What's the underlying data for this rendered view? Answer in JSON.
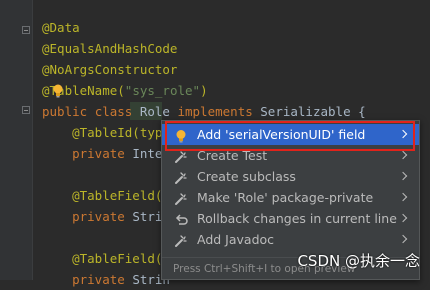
{
  "code_lines": [
    {
      "segments": [
        {
          "t": "@Data",
          "c": "ann"
        }
      ]
    },
    {
      "segments": [
        {
          "t": "@EqualsAndHashCode",
          "c": "ann"
        }
      ]
    },
    {
      "segments": [
        {
          "t": "@NoArgsConstructor",
          "c": "ann"
        }
      ]
    },
    {
      "segments": [
        {
          "t": "@TableName(",
          "c": "ann"
        },
        {
          "t": "\"sys_role\"",
          "c": "str"
        },
        {
          "t": ")",
          "c": "ann"
        }
      ]
    },
    {
      "segments": [
        {
          "t": "public ",
          "c": "kw"
        },
        {
          "t": "class ",
          "c": "kw"
        },
        {
          "t": "Role ",
          "c": "cls"
        },
        {
          "t": "implements ",
          "c": "kw"
        },
        {
          "t": "Serializable {",
          "c": "cls"
        }
      ]
    },
    {
      "segments": [
        {
          "t": "    @TableId(type",
          "c": "ann"
        }
      ]
    },
    {
      "segments": [
        {
          "t": "    private ",
          "c": "kw"
        },
        {
          "t": "Integ",
          "c": "cls"
        }
      ]
    },
    {
      "segments": [
        {
          "t": "",
          "c": "cls"
        }
      ]
    },
    {
      "segments": [
        {
          "t": "    @TableField(v",
          "c": "ann"
        }
      ]
    },
    {
      "segments": [
        {
          "t": "    private ",
          "c": "kw"
        },
        {
          "t": "Strin",
          "c": "cls"
        }
      ]
    },
    {
      "segments": [
        {
          "t": "",
          "c": "cls"
        }
      ]
    },
    {
      "segments": [
        {
          "t": "    @TableField(v",
          "c": "ann"
        }
      ]
    },
    {
      "segments": [
        {
          "t": "    private ",
          "c": "kw"
        },
        {
          "t": "Strin",
          "c": "cls"
        }
      ]
    }
  ],
  "popup": {
    "items": [
      {
        "label": "Add 'serialVersionUID' field",
        "icon": "bulb-icon",
        "selected": true
      },
      {
        "label": "Create Test",
        "icon": "quickfix-icon",
        "selected": false
      },
      {
        "label": "Create subclass",
        "icon": "quickfix-icon",
        "selected": false
      },
      {
        "label": "Make 'Role' package-private",
        "icon": "quickfix-icon",
        "selected": false
      },
      {
        "label": "Rollback changes in current line",
        "icon": "rollback-icon",
        "selected": false
      },
      {
        "label": "Add Javadoc",
        "icon": "quickfix-icon",
        "selected": false
      }
    ],
    "footer": "Press Ctrl+Shift+I to open preview"
  },
  "watermark": "CSDN @执余一念",
  "colors": {
    "editor_bg": "#2b2b2b",
    "annotation": "#bbb529",
    "keyword": "#cc7832",
    "string": "#6a8759",
    "selection": "#2f65ca",
    "highlight_box": "#e2231a"
  }
}
